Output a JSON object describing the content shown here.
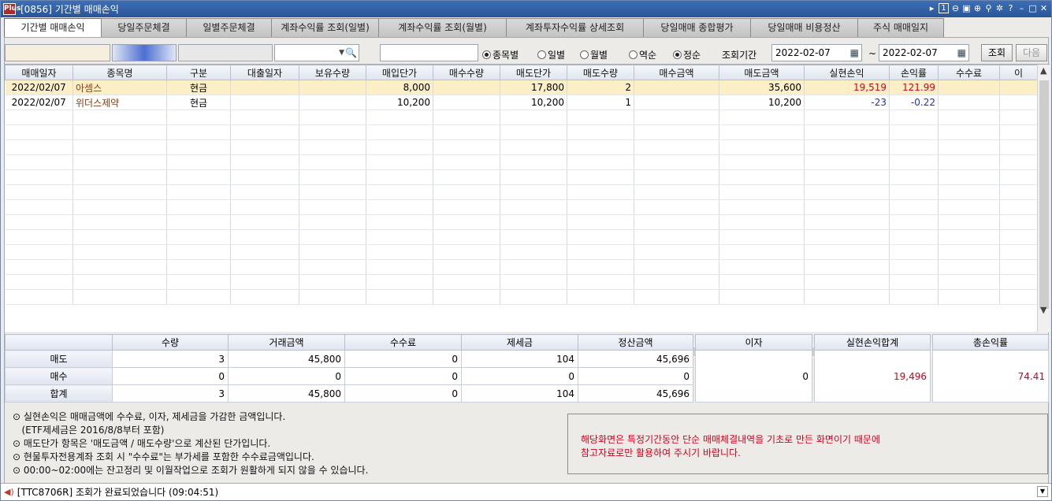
{
  "window": {
    "title": "[0856] 기간별 매매손익",
    "app_logo": "Plus",
    "page_num": "1"
  },
  "tabs": [
    "기간별 매매손익",
    "당일주문체결",
    "일별주문체결",
    "계좌수익률 조회(일별)",
    "계좌수익률 조회(월별)",
    "계좌투자수익률 상세조회",
    "당일매매 종합평가",
    "당일매매 비용정산",
    "주식 매매일지"
  ],
  "filters": {
    "radios_view": [
      {
        "label": "종목별",
        "on": true
      },
      {
        "label": "일별",
        "on": false
      },
      {
        "label": "월별",
        "on": false
      }
    ],
    "radios_order": [
      {
        "label": "역순",
        "on": false
      },
      {
        "label": "정순",
        "on": true
      }
    ],
    "period_label": "조회기간",
    "date_from": "2022-02-07",
    "tilde": "~",
    "date_to": "2022-02-07",
    "query_btn": "조회",
    "next_btn": "다음"
  },
  "grid": {
    "columns": [
      "매매일자",
      "종목명",
      "구분",
      "대출일자",
      "보유수량",
      "매입단가",
      "매수수량",
      "매도단가",
      "매도수량",
      "매수금액",
      "매도금액",
      "실현손익",
      "손익률",
      "수수료",
      "이"
    ],
    "rows": [
      [
        "2022/02/07",
        "아셈스",
        "현금",
        "",
        "",
        "8,000",
        "",
        "17,800",
        "2",
        "",
        "35,600",
        "19,519",
        "121.99",
        "",
        ""
      ],
      [
        "2022/02/07",
        "위더스제약",
        "현금",
        "",
        "",
        "10,200",
        "",
        "10,200",
        "1",
        "",
        "10,200",
        "-23",
        "-0.22",
        "",
        ""
      ]
    ]
  },
  "summary": {
    "columns": [
      "수량",
      "거래금액",
      "수수료",
      "제세금",
      "정산금액"
    ],
    "rows": [
      {
        "label": "매도",
        "values": [
          "3",
          "45,800",
          "0",
          "104",
          "45,696"
        ]
      },
      {
        "label": "매수",
        "values": [
          "0",
          "0",
          "0",
          "0",
          "0"
        ]
      },
      {
        "label": "합계",
        "values": [
          "3",
          "45,800",
          "0",
          "104",
          "45,696"
        ]
      }
    ],
    "interest_label": "이자",
    "interest_value": "0",
    "realized_label": "실현손익합계",
    "realized_value": "19,496",
    "total_rate_label": "총손익률",
    "total_rate_value": "74.41"
  },
  "notes": [
    "⊙ 실현손익은 매매금액에 수수료, 이자, 제세금을 가감한 금액입니다.",
    "   (ETF제세금은 2016/8/8부터 포함)",
    "⊙ 매도단가 항목은 '매도금액 / 매도수량'으로 계산된 단가입니다.",
    "⊙ 현물투자전용계좌 조회 시 \"수수료\"는 부가세를 포함한 수수료금액입니다.",
    "⊙ 00:00~02:00에는 잔고정리 및 이월작업으로 조회가 원활하게 되지 않을 수 있습니다."
  ],
  "warning": [
    "해당화면은 특정기간동안 단순 매매체결내역을 기초로 만든 화면이기 때문에",
    "참고자료로만 활용하여 주시기 바랍니다."
  ],
  "status": "[TTC8706R] 조회가 완료되었습니다 (09:04:51)",
  "colors": {
    "profit": "#d4001a",
    "loss": "#1c2fd1",
    "name": "#8a3a10",
    "selected_row": "#fcefc6"
  }
}
